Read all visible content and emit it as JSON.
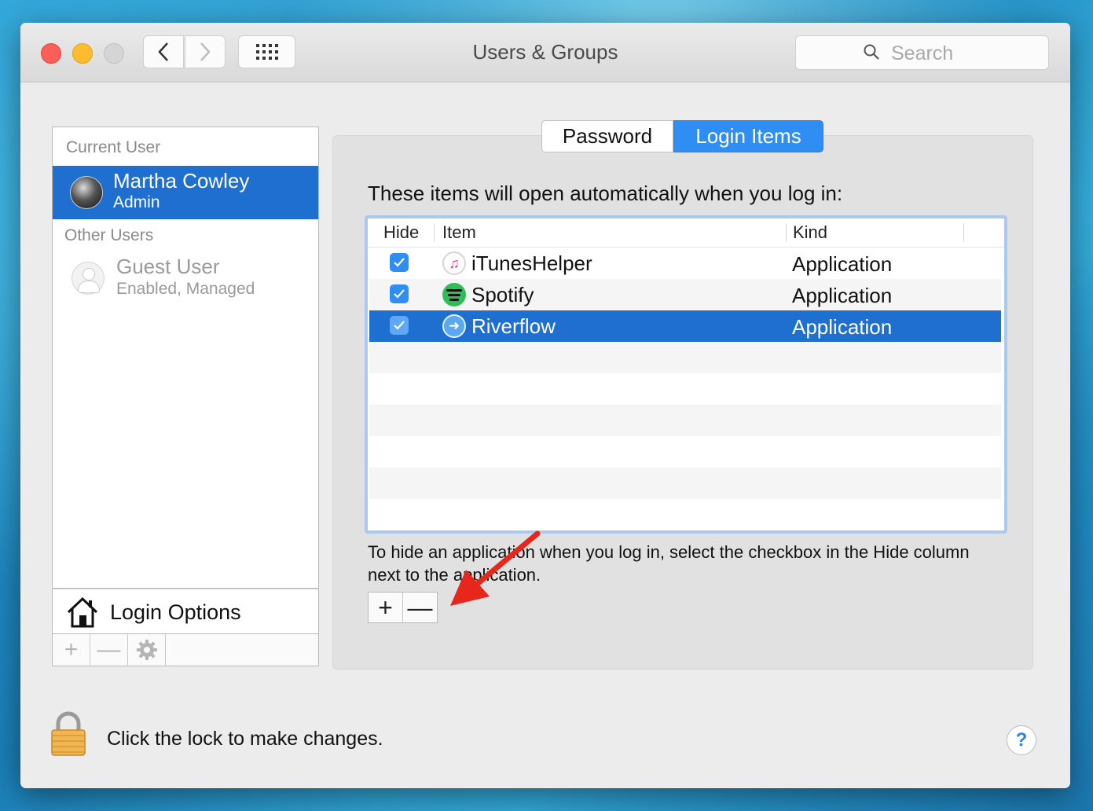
{
  "window": {
    "title": "Users & Groups"
  },
  "toolbar": {
    "search_placeholder": "Search"
  },
  "sidebar": {
    "current_user_heading": "Current User",
    "current_user": {
      "name": "Martha Cowley",
      "role": "Admin"
    },
    "other_users_heading": "Other Users",
    "other_users": [
      {
        "name": "Guest User",
        "role": "Enabled, Managed"
      }
    ],
    "login_options_label": "Login Options",
    "footer_buttons": [
      "+",
      "—",
      "gear"
    ]
  },
  "tabs": [
    {
      "label": "Password",
      "selected": false
    },
    {
      "label": "Login Items",
      "selected": true
    }
  ],
  "login_items": {
    "intro": "These items will open automatically when you log in:",
    "columns": {
      "hide": "Hide",
      "item": "Item",
      "kind": "Kind"
    },
    "rows": [
      {
        "name": "iTunesHelper",
        "kind": "Application",
        "hide_checked": true,
        "icon": "itunes-icon",
        "selected": false
      },
      {
        "name": "Spotify",
        "kind": "Application",
        "hide_checked": true,
        "icon": "spotify-icon",
        "selected": false
      },
      {
        "name": "Riverflow",
        "kind": "Application",
        "hide_checked": true,
        "icon": "riverflow-icon",
        "selected": true
      }
    ],
    "hint": "To hide an application when you log in, select the checkbox in the Hide column next to the application.",
    "add_label": "+",
    "remove_label": "—"
  },
  "footer": {
    "lock_text": "Click the lock to make changes.",
    "help_label": "?"
  },
  "colors": {
    "selection": "#1e6fd0",
    "accent": "#2f8ef4",
    "annotation_arrow": "#e8271c"
  }
}
